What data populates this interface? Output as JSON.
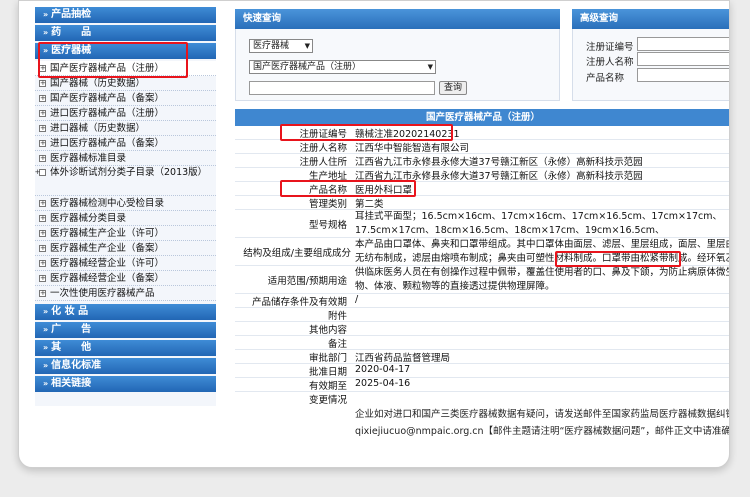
{
  "sidebar": {
    "sections_top": [
      {
        "label": "产品抽检"
      },
      {
        "label": "药　　品"
      },
      {
        "label": "医疗器械"
      }
    ],
    "items": [
      {
        "label": "国产医疗器械产品（注册）"
      },
      {
        "label": "国产器械（历史数据）"
      },
      {
        "label": "国产医疗器械产品（备案）"
      },
      {
        "label": "进口医疗器械产品（注册）"
      },
      {
        "label": "进口器械（历史数据）"
      },
      {
        "label": "进口医疗器械产品（备案）"
      },
      {
        "label": "医疗器械标准目录"
      },
      {
        "label": "体外诊断试剂分类子目录（2013版）"
      },
      {
        "label": "医疗器械检测中心受检目录"
      },
      {
        "label": "医疗器械分类目录"
      },
      {
        "label": "医疗器械生产企业（许可）"
      },
      {
        "label": "医疗器械生产企业（备案）"
      },
      {
        "label": "医疗器械经营企业（许可）"
      },
      {
        "label": "医疗器械经营企业（备案）"
      },
      {
        "label": "一次性使用医疗器械产品"
      }
    ],
    "sections_bottom": [
      {
        "label": "化 妆 品"
      },
      {
        "label": "广　　告"
      },
      {
        "label": "其　　他"
      },
      {
        "label": "信息化标准"
      },
      {
        "label": "相关链接"
      }
    ]
  },
  "quick_search": {
    "title": "快速查询",
    "category_value": "医疗器械",
    "subcategory_value": "国产医疗器械产品（注册）",
    "query_value": "",
    "button_label": "查询"
  },
  "advanced_search": {
    "title": "高级查询",
    "fields": [
      {
        "label": "注册证编号",
        "value": ""
      },
      {
        "label": "注册人名称",
        "value": ""
      },
      {
        "label": "产品名称",
        "value": ""
      }
    ]
  },
  "detail": {
    "title": "国产医疗器械产品（注册）",
    "rows": [
      {
        "key": "注册证编号",
        "value": "赣械注准20202140231"
      },
      {
        "key": "注册人名称",
        "value": "江西华中智能智造有限公司"
      },
      {
        "key": "注册人住所",
        "value": "江西省九江市永修县永修大道37号赣江新区（永修）高新科技示范园"
      },
      {
        "key": "生产地址",
        "value": "江西省九江市永修县永修大道37号赣江新区（永修）高新科技示范园"
      },
      {
        "key": "产品名称",
        "value": "医用外科口罩"
      },
      {
        "key": "管理类别",
        "value": "第二类"
      },
      {
        "key": "型号规格",
        "value": "耳挂式平面型；16.5cm×16cm、17cm×16cm、17cm×16.5cm、17cm×17cm、17.5cm×17cm、18cm×16.5cm、18cm×17cm、19cm×16.5cm、19cm×17cm。"
      },
      {
        "key": "结构及组成/主要组成成分",
        "value": "本产品由口罩体、鼻夹和口罩带组成。其中口罩体由面层、滤层、里层组成，面层、里层由无纺布制成，滤层由熔喷布制成；鼻夹由可塑性材料制成。口罩带由松紧带制成。经环氧乙烷灭菌，产品无菌。"
      },
      {
        "key": "适用范围/预期用途",
        "value": "供临床医务人员在有创操作过程中佩带，覆盖住使用者的口、鼻及下颌，为防止病原体微生物、体液、颗粒物等的直接透过提供物理屏障。"
      },
      {
        "key": "产品储存条件及有效期",
        "value": "/"
      },
      {
        "key": "附件",
        "value": ""
      },
      {
        "key": "其他内容",
        "value": ""
      },
      {
        "key": "备注",
        "value": ""
      },
      {
        "key": "审批部门",
        "value": "江西省药品监督管理局"
      },
      {
        "key": "批准日期",
        "value": "2020-04-17"
      },
      {
        "key": "有效期至",
        "value": "2025-04-16"
      },
      {
        "key": "变更情况",
        "value": ""
      }
    ],
    "footer_line1": "企业如对进口和国产三类医疗器械数据有疑问，请发送邮件至国家药监局医疗器械数据纠错邮箱：",
    "footer_line2": "qixiejiucuo@nmpaic.org.cn【邮件主题请注明“医疗器械数据问题”，邮件正文中请准确填写"
  },
  "colors": {
    "header_blue": "#2a6fba",
    "highlight_red": "#e8141c"
  }
}
